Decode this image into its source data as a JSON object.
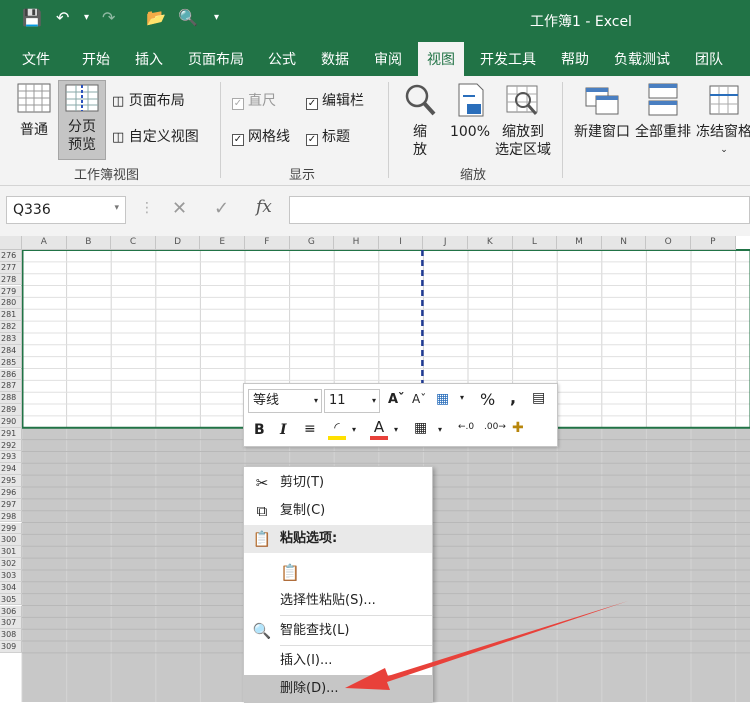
{
  "title_bar": {
    "title": "工作簿1 - Excel"
  },
  "tabs": [
    {
      "label": "文件"
    },
    {
      "label": "开始"
    },
    {
      "label": "插入"
    },
    {
      "label": "页面布局"
    },
    {
      "label": "公式"
    },
    {
      "label": "数据"
    },
    {
      "label": "审阅"
    },
    {
      "label": "视图",
      "active": true
    },
    {
      "label": "开发工具"
    },
    {
      "label": "帮助"
    },
    {
      "label": "负载测试"
    },
    {
      "label": "团队"
    }
  ],
  "ribbon": {
    "workbook_views": {
      "normal": "普通",
      "page_break_line1": "分页",
      "page_break_line2": "预览",
      "page_layout": "页面布局",
      "custom_views": "自定义视图",
      "group_label": "工作簿视图"
    },
    "show": {
      "ruler": "直尺",
      "formula_bar": "编辑栏",
      "gridlines": "网格线",
      "headings": "标题",
      "group_label": "显示"
    },
    "zoom": {
      "zoom_line1": "缩",
      "zoom_line2": "放",
      "hundred": "100%",
      "to_selection_line1": "缩放到",
      "to_selection_line2": "选定区域",
      "group_label": "缩放"
    },
    "window": {
      "new_window": "新建窗口",
      "arrange_all": "全部重排",
      "freeze_panes": "冻结窗格"
    }
  },
  "formula_bar": {
    "name_box": "Q336",
    "fx": "fx"
  },
  "columns": [
    "A",
    "B",
    "C",
    "D",
    "E",
    "F",
    "G",
    "H",
    "I",
    "J",
    "K",
    "L",
    "M",
    "N",
    "O",
    "P"
  ],
  "rows": [
    "276",
    "277",
    "278",
    "279",
    "280",
    "281",
    "282",
    "283",
    "284",
    "285",
    "286",
    "287",
    "288",
    "289",
    "290",
    "291",
    "292",
    "293",
    "294",
    "295",
    "296",
    "297",
    "298",
    "299",
    "300",
    "301",
    "302",
    "303",
    "304",
    "305",
    "306",
    "307",
    "308",
    "309"
  ],
  "mini_toolbar": {
    "font": "等线",
    "size": "11",
    "percent": "%",
    "comma": ","
  },
  "context_menu": {
    "cut": "剪切(T)",
    "copy": "复制(C)",
    "paste_options": "粘贴选项:",
    "paste_special": "选择性粘贴(S)...",
    "smart_lookup": "智能查找(L)",
    "insert": "插入(I)...",
    "delete": "删除(D)..."
  },
  "colors": {
    "excel_green": "#217346",
    "arrow_red": "#e8413a",
    "gray_area": "#c8c8c8"
  }
}
